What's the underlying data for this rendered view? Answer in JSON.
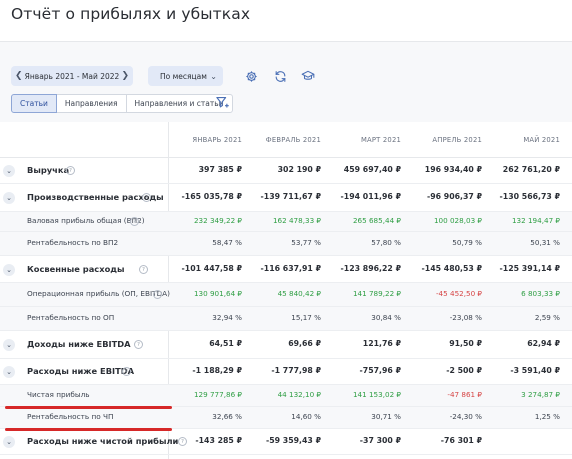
{
  "title": "Отчёт о прибылях и убытках",
  "toolbar": {
    "period": "Январь 2021 - Май 2022",
    "mode": "По месяцам",
    "prev_icon": "chevron-left-icon",
    "next_icon": "chevron-right-icon",
    "settings_icon": "gear-icon",
    "refresh_icon": "refresh-icon",
    "learn_icon": "graduation-cap-icon",
    "filter_icon": "filter-add-icon"
  },
  "tabs": [
    {
      "label": "Статьи",
      "active": true
    },
    {
      "label": "Направления",
      "active": false
    },
    {
      "label": "Направления и статьи",
      "active": false
    }
  ],
  "columns": [
    "ЯНВАРЬ 2021",
    "ФЕВРАЛЬ 2021",
    "МАРТ 2021",
    "АПРЕЛЬ 2021",
    "МАЙ 2021"
  ],
  "rows": [
    {
      "label": "Выручка",
      "type": "main",
      "expander": true,
      "info": true,
      "values": [
        "397 385 ₽",
        "302 190 ₽",
        "459 697,40 ₽",
        "196 934,40 ₽",
        "262 761,20 ₽"
      ],
      "tone": [
        "",
        "",
        "",
        "",
        ""
      ]
    },
    {
      "label": "Производственные расходы",
      "type": "main",
      "expander": true,
      "info": true,
      "values": [
        "-165 035,78 ₽",
        "-139 711,67 ₽",
        "-194 011,96 ₽",
        "-96 906,37 ₽",
        "-130 566,73 ₽"
      ],
      "tone": [
        "",
        "",
        "",
        "",
        ""
      ]
    },
    {
      "label": "Валовая прибыль общая (ВП2)",
      "type": "sub",
      "expander": false,
      "info": true,
      "values": [
        "232 349,22 ₽",
        "162 478,33 ₽",
        "265 685,44 ₽",
        "100 028,03 ₽",
        "132 194,47 ₽"
      ],
      "tone": [
        "green",
        "green",
        "green",
        "green",
        "green"
      ]
    },
    {
      "label": "Рентабельность по ВП2",
      "type": "sub",
      "expander": false,
      "info": false,
      "values": [
        "58,47 %",
        "53,77 %",
        "57,80 %",
        "50,79 %",
        "50,31 %"
      ],
      "tone": [
        "",
        "",
        "",
        "",
        ""
      ]
    },
    {
      "label": "Косвенные расходы",
      "type": "main",
      "expander": true,
      "info": true,
      "values": [
        "-101 447,58 ₽",
        "-116 637,91 ₽",
        "-123 896,22 ₽",
        "-145 480,53 ₽",
        "-125 391,14 ₽"
      ],
      "tone": [
        "",
        "",
        "",
        "",
        ""
      ]
    },
    {
      "label": "Операционная прибыль (ОП, EBITDA)",
      "type": "sub",
      "expander": false,
      "info": true,
      "values": [
        "130 901,64 ₽",
        "45 840,42 ₽",
        "141 789,22 ₽",
        "-45 452,50 ₽",
        "6 803,33 ₽"
      ],
      "tone": [
        "green",
        "green",
        "green",
        "red",
        "green"
      ]
    },
    {
      "label": "Рентабельность по ОП",
      "type": "sub",
      "expander": false,
      "info": false,
      "values": [
        "32,94 %",
        "15,17 %",
        "30,84 %",
        "-23,08 %",
        "2,59 %"
      ],
      "tone": [
        "",
        "",
        "",
        "",
        ""
      ]
    },
    {
      "label": "Доходы ниже EBITDA",
      "type": "main",
      "expander": true,
      "info": true,
      "values": [
        "64,51 ₽",
        "69,66 ₽",
        "121,76 ₽",
        "91,50 ₽",
        "62,94 ₽"
      ],
      "tone": [
        "",
        "",
        "",
        "",
        ""
      ]
    },
    {
      "label": "Расходы ниже EBITDA",
      "type": "main",
      "expander": true,
      "info": true,
      "values": [
        "-1 188,29 ₽",
        "-1 777,98 ₽",
        "-757,96 ₽",
        "-2 500 ₽",
        "-3 591,40 ₽"
      ],
      "tone": [
        "",
        "",
        "",
        "",
        ""
      ]
    },
    {
      "label": "Чистая прибыль",
      "type": "sub",
      "expander": false,
      "info": false,
      "values": [
        "129 777,86 ₽",
        "44 132,10 ₽",
        "141 153,02 ₽",
        "-47 861 ₽",
        "3 274,87 ₽"
      ],
      "tone": [
        "green",
        "green",
        "green",
        "red",
        "green"
      ]
    },
    {
      "label": "Рентабельность по ЧП",
      "type": "sub",
      "expander": false,
      "info": false,
      "values": [
        "32,66 %",
        "14,60 %",
        "30,71 %",
        "-24,30 %",
        "1,25 %"
      ],
      "tone": [
        "",
        "",
        "",
        "",
        ""
      ]
    },
    {
      "label": "Расходы ниже чистой прибыли",
      "type": "main",
      "expander": true,
      "info": true,
      "values": [
        "-143 285 ₽",
        "-59 359,43 ₽",
        "-37 300 ₽",
        "-76 301 ₽",
        ""
      ],
      "tone": [
        "",
        "",
        "",
        "",
        ""
      ]
    }
  ],
  "colors": {
    "accent": "#2d4f9c",
    "positive": "#2f9e44",
    "negative": "#d64545",
    "highlight": "#d62828"
  }
}
